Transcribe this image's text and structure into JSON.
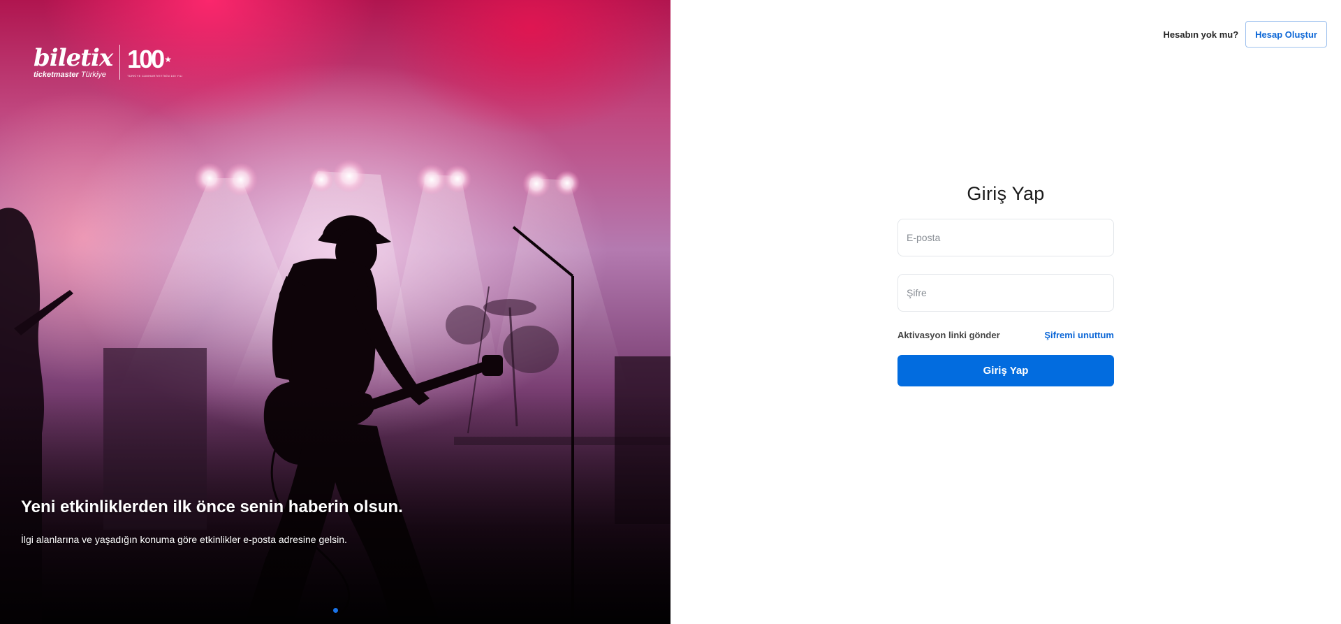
{
  "brand": {
    "name": "biletix",
    "sub_bold": "ticketmaster",
    "sub_light": "Türkiye",
    "centennial_number": "100",
    "centennial_caption": "TÜRKİYE CUMHURİYETİ'NİN 100 YILI"
  },
  "hero": {
    "title": "Yeni etkinliklerden ilk önce senin haberin olsun.",
    "description": "İlgi alanlarına ve yaşadığın konuma göre etkinlikler e-posta adresine gelsin.",
    "slides_total": 2,
    "active_slide": 1
  },
  "topbar": {
    "no_account": "Hesabın yok mu?",
    "create_account": "Hesap Oluştur"
  },
  "login": {
    "title": "Giriş Yap",
    "email_placeholder": "E-posta",
    "password_placeholder": "Şifre",
    "activation_link": "Aktivasyon linki gönder",
    "forgot_password": "Şifremi unuttum",
    "submit_label": "Giriş Yap"
  },
  "colors": {
    "primary": "#026cdf",
    "link": "#0b66d6"
  }
}
